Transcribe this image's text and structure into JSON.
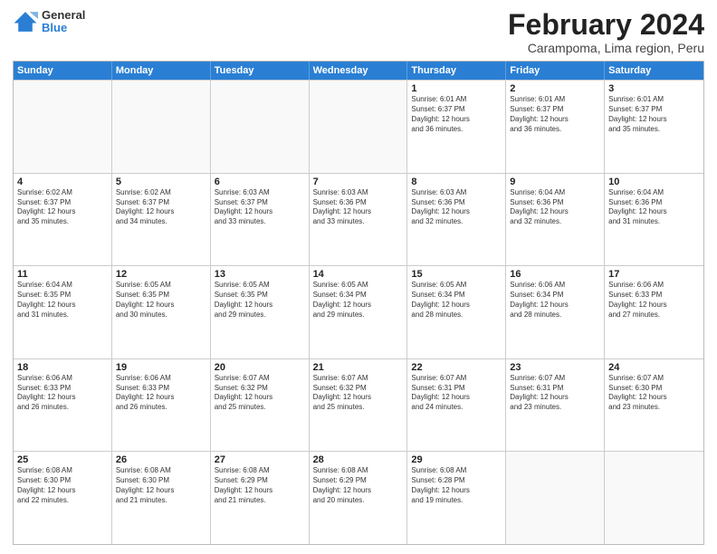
{
  "logo": {
    "general": "General",
    "blue": "Blue"
  },
  "header": {
    "title": "February 2024",
    "subtitle": "Carampoma, Lima region, Peru"
  },
  "days_of_week": [
    "Sunday",
    "Monday",
    "Tuesday",
    "Wednesday",
    "Thursday",
    "Friday",
    "Saturday"
  ],
  "weeks": [
    [
      {
        "day": "",
        "info": "",
        "empty": true
      },
      {
        "day": "",
        "info": "",
        "empty": true
      },
      {
        "day": "",
        "info": "",
        "empty": true
      },
      {
        "day": "",
        "info": "",
        "empty": true
      },
      {
        "day": "1",
        "info": "Sunrise: 6:01 AM\nSunset: 6:37 PM\nDaylight: 12 hours\nand 36 minutes."
      },
      {
        "day": "2",
        "info": "Sunrise: 6:01 AM\nSunset: 6:37 PM\nDaylight: 12 hours\nand 36 minutes."
      },
      {
        "day": "3",
        "info": "Sunrise: 6:01 AM\nSunset: 6:37 PM\nDaylight: 12 hours\nand 35 minutes."
      }
    ],
    [
      {
        "day": "4",
        "info": "Sunrise: 6:02 AM\nSunset: 6:37 PM\nDaylight: 12 hours\nand 35 minutes."
      },
      {
        "day": "5",
        "info": "Sunrise: 6:02 AM\nSunset: 6:37 PM\nDaylight: 12 hours\nand 34 minutes."
      },
      {
        "day": "6",
        "info": "Sunrise: 6:03 AM\nSunset: 6:37 PM\nDaylight: 12 hours\nand 33 minutes."
      },
      {
        "day": "7",
        "info": "Sunrise: 6:03 AM\nSunset: 6:36 PM\nDaylight: 12 hours\nand 33 minutes."
      },
      {
        "day": "8",
        "info": "Sunrise: 6:03 AM\nSunset: 6:36 PM\nDaylight: 12 hours\nand 32 minutes."
      },
      {
        "day": "9",
        "info": "Sunrise: 6:04 AM\nSunset: 6:36 PM\nDaylight: 12 hours\nand 32 minutes."
      },
      {
        "day": "10",
        "info": "Sunrise: 6:04 AM\nSunset: 6:36 PM\nDaylight: 12 hours\nand 31 minutes."
      }
    ],
    [
      {
        "day": "11",
        "info": "Sunrise: 6:04 AM\nSunset: 6:35 PM\nDaylight: 12 hours\nand 31 minutes."
      },
      {
        "day": "12",
        "info": "Sunrise: 6:05 AM\nSunset: 6:35 PM\nDaylight: 12 hours\nand 30 minutes."
      },
      {
        "day": "13",
        "info": "Sunrise: 6:05 AM\nSunset: 6:35 PM\nDaylight: 12 hours\nand 29 minutes."
      },
      {
        "day": "14",
        "info": "Sunrise: 6:05 AM\nSunset: 6:34 PM\nDaylight: 12 hours\nand 29 minutes."
      },
      {
        "day": "15",
        "info": "Sunrise: 6:05 AM\nSunset: 6:34 PM\nDaylight: 12 hours\nand 28 minutes."
      },
      {
        "day": "16",
        "info": "Sunrise: 6:06 AM\nSunset: 6:34 PM\nDaylight: 12 hours\nand 28 minutes."
      },
      {
        "day": "17",
        "info": "Sunrise: 6:06 AM\nSunset: 6:33 PM\nDaylight: 12 hours\nand 27 minutes."
      }
    ],
    [
      {
        "day": "18",
        "info": "Sunrise: 6:06 AM\nSunset: 6:33 PM\nDaylight: 12 hours\nand 26 minutes."
      },
      {
        "day": "19",
        "info": "Sunrise: 6:06 AM\nSunset: 6:33 PM\nDaylight: 12 hours\nand 26 minutes."
      },
      {
        "day": "20",
        "info": "Sunrise: 6:07 AM\nSunset: 6:32 PM\nDaylight: 12 hours\nand 25 minutes."
      },
      {
        "day": "21",
        "info": "Sunrise: 6:07 AM\nSunset: 6:32 PM\nDaylight: 12 hours\nand 25 minutes."
      },
      {
        "day": "22",
        "info": "Sunrise: 6:07 AM\nSunset: 6:31 PM\nDaylight: 12 hours\nand 24 minutes."
      },
      {
        "day": "23",
        "info": "Sunrise: 6:07 AM\nSunset: 6:31 PM\nDaylight: 12 hours\nand 23 minutes."
      },
      {
        "day": "24",
        "info": "Sunrise: 6:07 AM\nSunset: 6:30 PM\nDaylight: 12 hours\nand 23 minutes."
      }
    ],
    [
      {
        "day": "25",
        "info": "Sunrise: 6:08 AM\nSunset: 6:30 PM\nDaylight: 12 hours\nand 22 minutes."
      },
      {
        "day": "26",
        "info": "Sunrise: 6:08 AM\nSunset: 6:30 PM\nDaylight: 12 hours\nand 21 minutes."
      },
      {
        "day": "27",
        "info": "Sunrise: 6:08 AM\nSunset: 6:29 PM\nDaylight: 12 hours\nand 21 minutes."
      },
      {
        "day": "28",
        "info": "Sunrise: 6:08 AM\nSunset: 6:29 PM\nDaylight: 12 hours\nand 20 minutes."
      },
      {
        "day": "29",
        "info": "Sunrise: 6:08 AM\nSunset: 6:28 PM\nDaylight: 12 hours\nand 19 minutes."
      },
      {
        "day": "",
        "info": "",
        "empty": true
      },
      {
        "day": "",
        "info": "",
        "empty": true
      }
    ]
  ]
}
